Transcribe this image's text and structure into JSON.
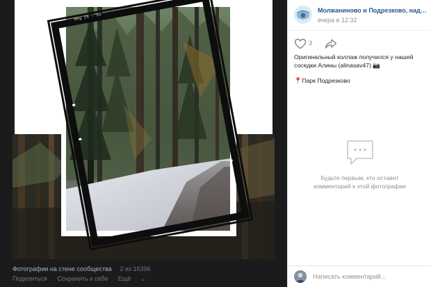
{
  "viewer": {
    "album_title": "Фотографии на стене сообщества",
    "counter": "2 из 16396",
    "actions": {
      "share": "Поделиться",
      "save": "Сохранить к себе",
      "more": "Ещё"
    },
    "frame_caption": "Neg 24 · 55"
  },
  "post": {
    "author": "Молжаниново и Подрезково, наде…",
    "time": "вчера в 12:32",
    "likes": "3",
    "text": "Оригинальный коллаж получился у нашей соседки Алины (alinasav47) 📷",
    "location": "Парк Подрезково"
  },
  "comments": {
    "empty_text": "Будьте первым, кто оставит комментарий к этой фотографии",
    "placeholder": "Написать комментарий..."
  },
  "colors": {
    "link": "#2a5885",
    "viewer_bg": "#1b1b1b",
    "muted": "#939393"
  },
  "icons": [
    "heart-icon",
    "share-arrow-icon",
    "comment-bubble-icon",
    "location-pin-icon",
    "chevron-down-icon"
  ]
}
